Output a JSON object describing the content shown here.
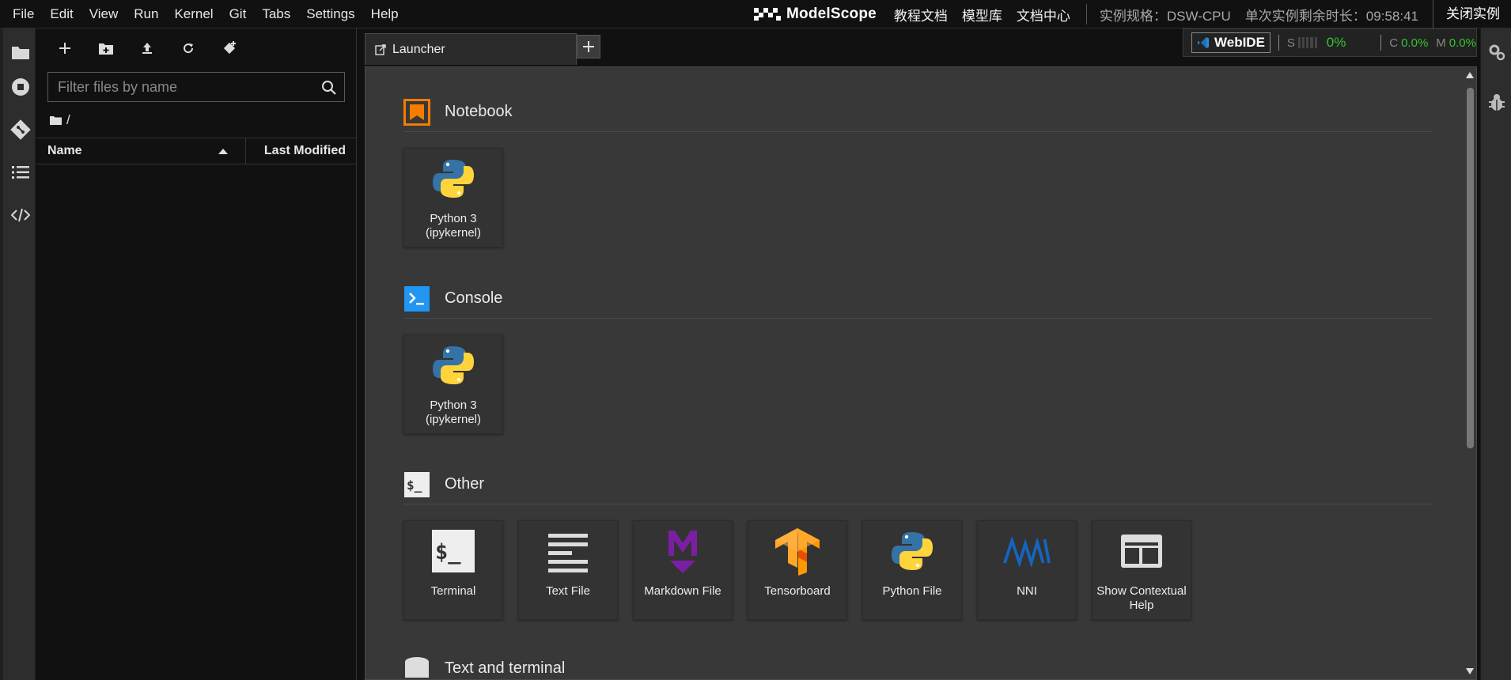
{
  "menu": [
    "File",
    "Edit",
    "View",
    "Run",
    "Kernel",
    "Git",
    "Tabs",
    "Settings",
    "Help"
  ],
  "brand": {
    "name": "ModelScope"
  },
  "top_links": [
    "教程文档",
    "模型库",
    "文档中心"
  ],
  "instance": {
    "spec": "实例规格：DSW-CPU",
    "remaining": "单次实例剩余时长：09:58:41",
    "close": "关闭实例"
  },
  "filebrowser": {
    "filter_placeholder": "Filter files by name",
    "path": "/",
    "col_name": "Name",
    "col_modified": "Last Modified"
  },
  "tabs": [
    {
      "label": "Launcher"
    }
  ],
  "status": {
    "webide": "WebIDE",
    "s_label": "S",
    "s_value": "0%",
    "c_label": "C",
    "c_value": "0.0%",
    "m_label": "M",
    "m_value": "0.0%"
  },
  "launcher": {
    "notebook": {
      "title": "Notebook",
      "cards": [
        {
          "label": "Python 3 (ipykernel)",
          "icon": "python-icon"
        }
      ]
    },
    "console": {
      "title": "Console",
      "cards": [
        {
          "label": "Python 3 (ipykernel)",
          "icon": "python-icon"
        }
      ]
    },
    "other": {
      "title": "Other",
      "cards": [
        {
          "label": "Terminal",
          "icon": "terminal-icon"
        },
        {
          "label": "Text File",
          "icon": "text-file-icon"
        },
        {
          "label": "Markdown File",
          "icon": "markdown-icon"
        },
        {
          "label": "Tensorboard",
          "icon": "tensorflow-icon"
        },
        {
          "label": "Python File",
          "icon": "python-icon"
        },
        {
          "label": "NNI",
          "icon": "nni-icon"
        },
        {
          "label": "Show Contextual Help",
          "icon": "contextual-help-icon"
        }
      ]
    },
    "next_section": {
      "title": "Text and terminal"
    }
  },
  "colors": {
    "notebook_accent": "#f57c00",
    "console_accent": "#2196f3",
    "status_green": "#35c335"
  }
}
